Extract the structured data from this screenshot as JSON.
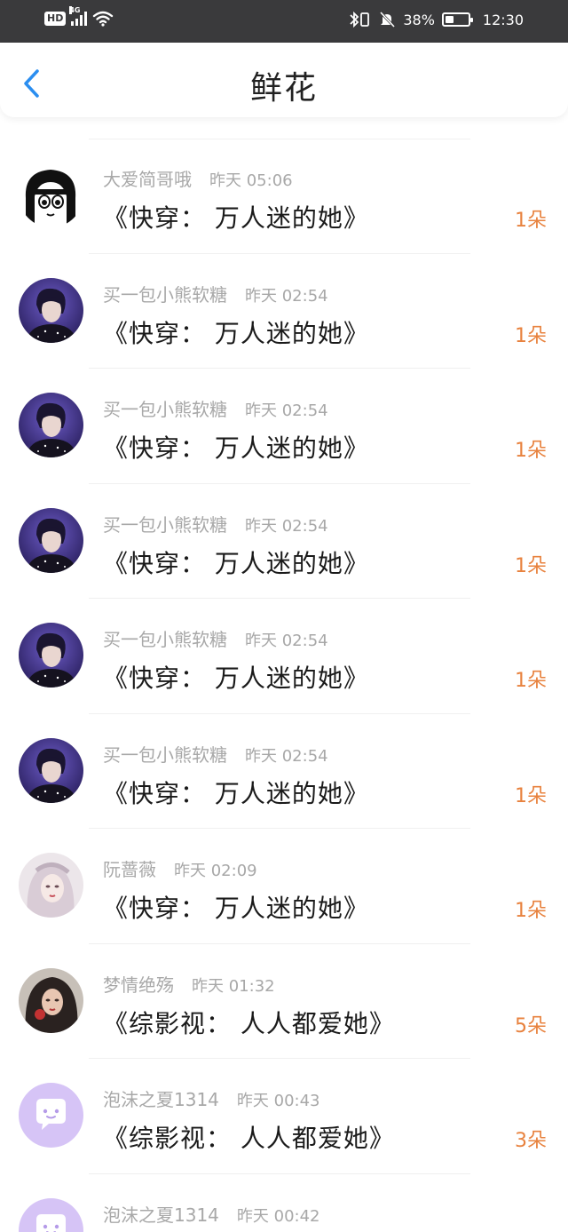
{
  "status_bar": {
    "hd": "HD",
    "network": "4G",
    "battery_text": "38%",
    "battery_level": 0.38,
    "time": "12:30"
  },
  "header": {
    "title": "鲜花"
  },
  "items": [
    {
      "name": "大爱简哥哦",
      "time": "昨天 05:06",
      "book": "《快穿： 万人迷的她》",
      "count": "1朵",
      "avatar": "manga-girl"
    },
    {
      "name": "买一包小熊软糖",
      "time": "昨天 02:54",
      "book": "《快穿： 万人迷的她》",
      "count": "1朵",
      "avatar": "boy-purple"
    },
    {
      "name": "买一包小熊软糖",
      "time": "昨天 02:54",
      "book": "《快穿： 万人迷的她》",
      "count": "1朵",
      "avatar": "boy-purple"
    },
    {
      "name": "买一包小熊软糖",
      "time": "昨天 02:54",
      "book": "《快穿： 万人迷的她》",
      "count": "1朵",
      "avatar": "boy-purple"
    },
    {
      "name": "买一包小熊软糖",
      "time": "昨天 02:54",
      "book": "《快穿： 万人迷的她》",
      "count": "1朵",
      "avatar": "boy-purple"
    },
    {
      "name": "买一包小熊软糖",
      "time": "昨天 02:54",
      "book": "《快穿： 万人迷的她》",
      "count": "1朵",
      "avatar": "boy-purple"
    },
    {
      "name": "阮蔷薇",
      "time": "昨天 02:09",
      "book": "《快穿： 万人迷的她》",
      "count": "1朵",
      "avatar": "pale-girl"
    },
    {
      "name": "梦情绝殇",
      "time": "昨天 01:32",
      "book": "《综影视： 人人都爱她》",
      "count": "5朵",
      "avatar": "dark-hair-girl"
    },
    {
      "name": "泡沫之夏1314",
      "time": "昨天 00:43",
      "book": "《综影视： 人人都爱她》",
      "count": "3朵",
      "avatar": "default-chat"
    },
    {
      "name": "泡沫之夏1314",
      "time": "昨天 00:42",
      "book": "",
      "count": "",
      "avatar": "default-chat"
    }
  ],
  "colors": {
    "accent_blue": "#2b8ef0",
    "count_orange": "#e8823e",
    "meta_gray": "#a8a8a8",
    "status_bar_bg": "#3a3a3c",
    "default_avatar": "#d6c4f6"
  }
}
